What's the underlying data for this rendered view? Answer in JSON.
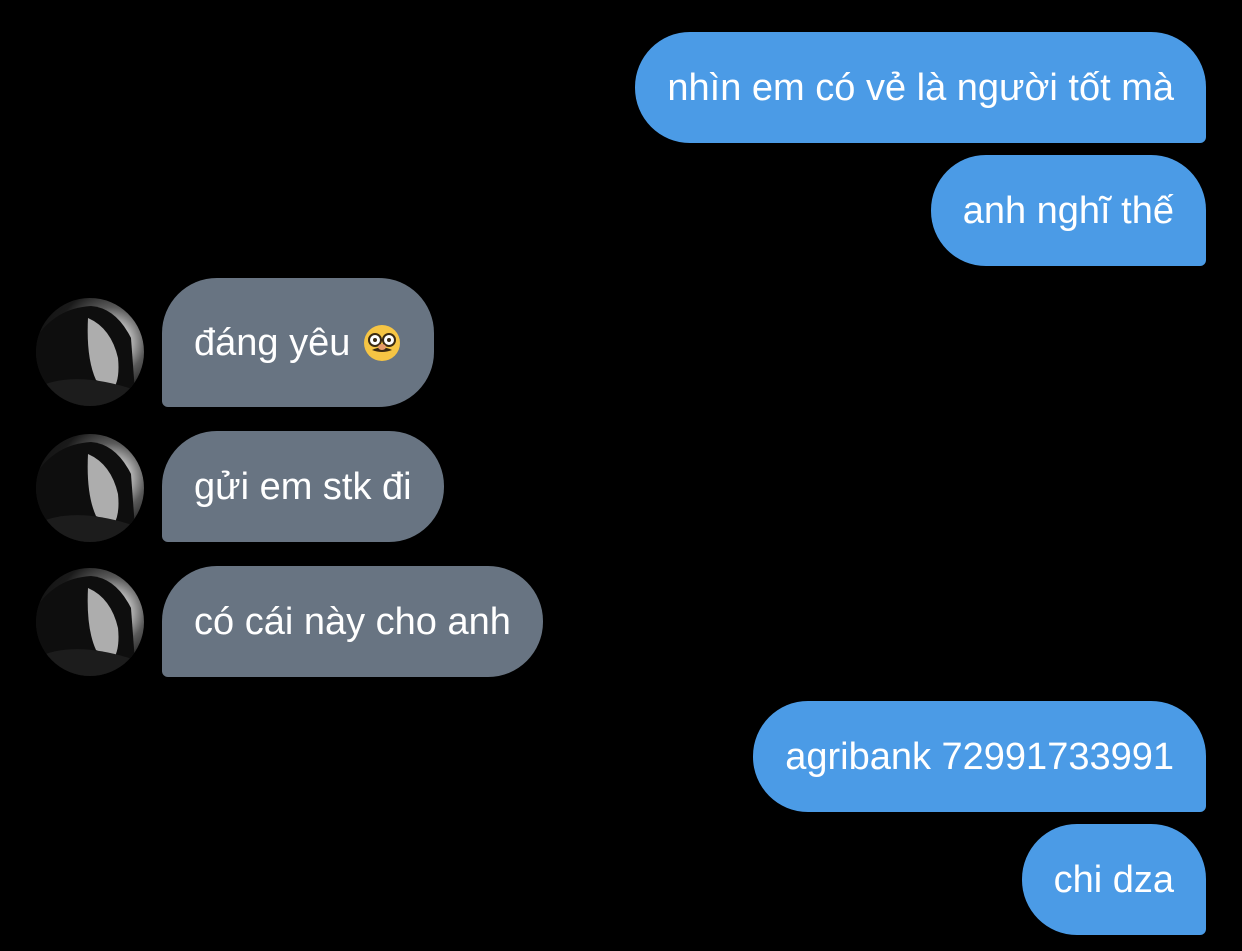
{
  "messages": [
    {
      "text": "nhìn em có vẻ là người tốt mà",
      "direction": "outgoing"
    },
    {
      "text": "anh nghĩ thế",
      "direction": "outgoing"
    },
    {
      "text": "đáng yêu",
      "direction": "incoming",
      "emoji": "disguised-face"
    },
    {
      "text": "gửi em stk đi",
      "direction": "incoming"
    },
    {
      "text": "có cái này cho anh",
      "direction": "incoming"
    },
    {
      "text": "agribank 72991733991",
      "direction": "outgoing"
    },
    {
      "text": "chi dza",
      "direction": "outgoing"
    }
  ],
  "colors": {
    "background": "#000000",
    "outgoing_bubble": "#4b9be6",
    "incoming_bubble": "#687482",
    "text": "#ffffff"
  }
}
